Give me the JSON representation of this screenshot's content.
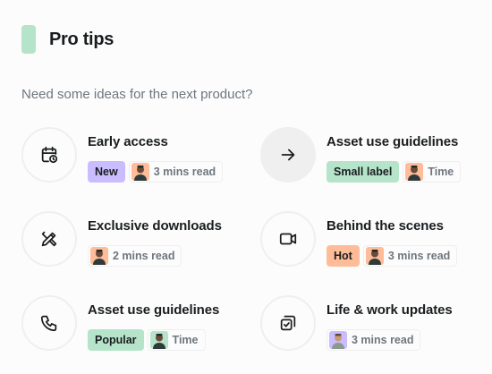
{
  "header": {
    "title": "Pro tips",
    "accent_color": "#b5e4ca"
  },
  "subtitle": "Need some ideas for the next product?",
  "tips": [
    {
      "title": "Early access",
      "icon": "calendar-clock-icon",
      "tag": "New",
      "tag_color": "#cabdff",
      "read": "3 mins read"
    },
    {
      "title": "Asset use guidelines",
      "icon": "arrow-right-icon",
      "tag": "Small label",
      "tag_color": "#b5e4ca",
      "read": "Time"
    },
    {
      "title": "Exclusive downloads",
      "icon": "pen-ruler-icon",
      "tag": "",
      "read": "2 mins read"
    },
    {
      "title": "Behind the scenes",
      "icon": "video-icon",
      "tag": "Hot",
      "tag_color": "#ffbc99",
      "read": "3 mins read"
    },
    {
      "title": "Asset use guidelines",
      "icon": "phone-icon",
      "tag": "Popular",
      "tag_color": "#b5e4ca",
      "read": "Time"
    },
    {
      "title": "Life & work updates",
      "icon": "copy-check-icon",
      "tag": "",
      "read": "3 mins read"
    }
  ]
}
